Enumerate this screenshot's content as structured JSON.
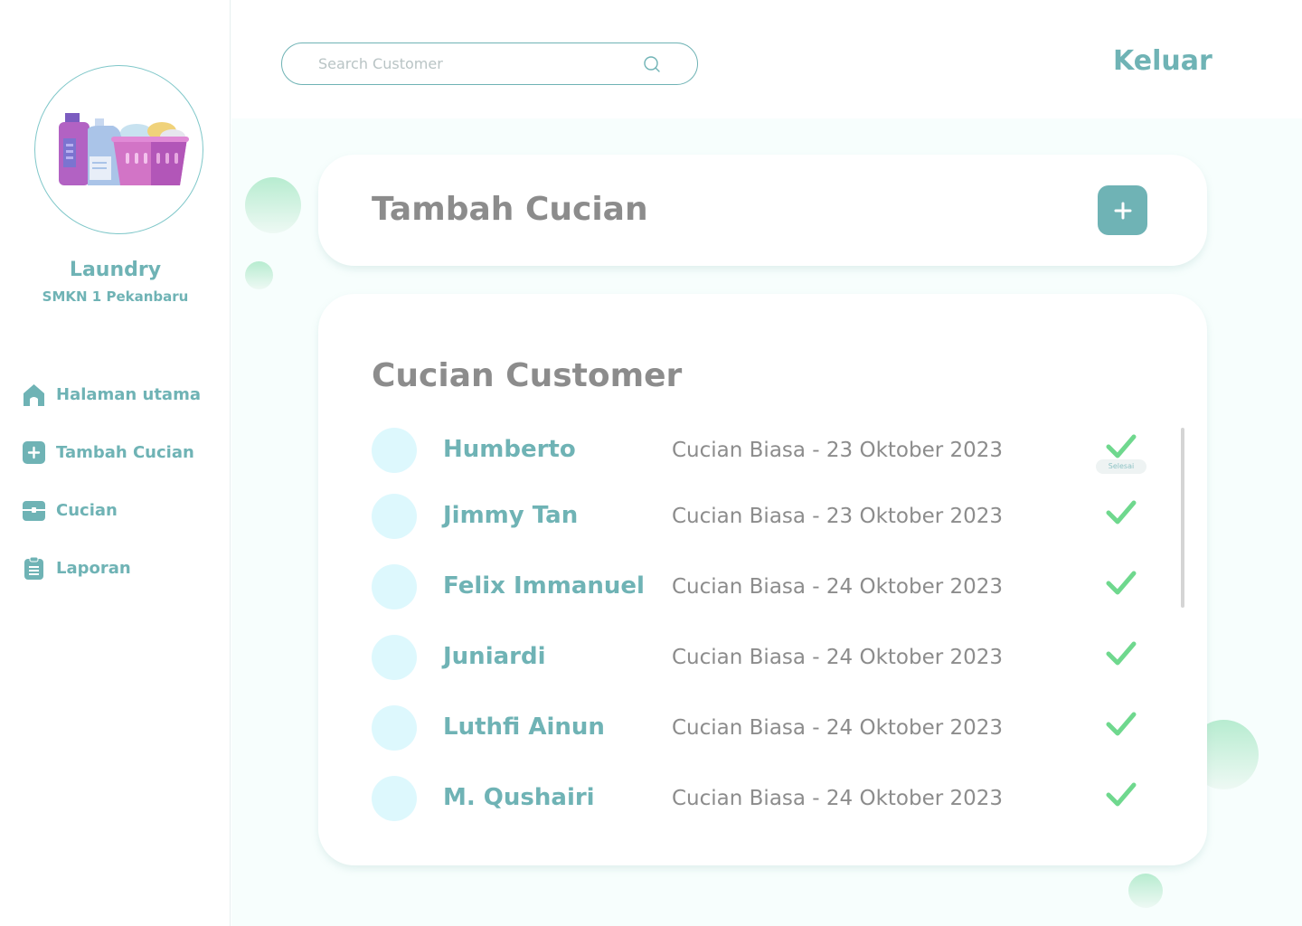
{
  "sidebar": {
    "brand_title": "Laundry",
    "brand_subtitle": "SMKN 1 Pekanbaru",
    "items": [
      {
        "label": "Halaman utama",
        "icon": "home-icon"
      },
      {
        "label": "Tambah Cucian",
        "icon": "plus-square-icon"
      },
      {
        "label": "Cucian",
        "icon": "box-icon"
      },
      {
        "label": "Laporan",
        "icon": "clipboard-icon"
      }
    ]
  },
  "header": {
    "search_placeholder": "Search Customer",
    "logout_label": "Keluar"
  },
  "add_card": {
    "title": "Tambah Cucian",
    "button_icon": "plus-icon"
  },
  "list": {
    "title": "Cucian Customer",
    "tooltip": "Selesai",
    "rows": [
      {
        "name": "Humberto",
        "info": "Cucian Biasa - 23 Oktober 2023",
        "status": "done"
      },
      {
        "name": "Jimmy Tan",
        "info": "Cucian Biasa - 23 Oktober 2023",
        "status": "done"
      },
      {
        "name": "Felix Immanuel",
        "info": "Cucian Biasa - 24 Oktober 2023",
        "status": "done"
      },
      {
        "name": "Juniardi",
        "info": "Cucian Biasa - 24 Oktober 2023",
        "status": "done"
      },
      {
        "name": "Luthfi Ainun",
        "info": "Cucian Biasa - 24 Oktober 2023",
        "status": "done"
      },
      {
        "name": "M. Qushairi",
        "info": "Cucian Biasa - 24 Oktober 2023",
        "status": "done"
      }
    ]
  },
  "colors": {
    "accent": "#6fb3b5",
    "text_gray": "#8c8c8c",
    "check_green": "#6fd88e",
    "avatar_bg": "#ddf8fd",
    "main_bg": "#f7fefd"
  }
}
